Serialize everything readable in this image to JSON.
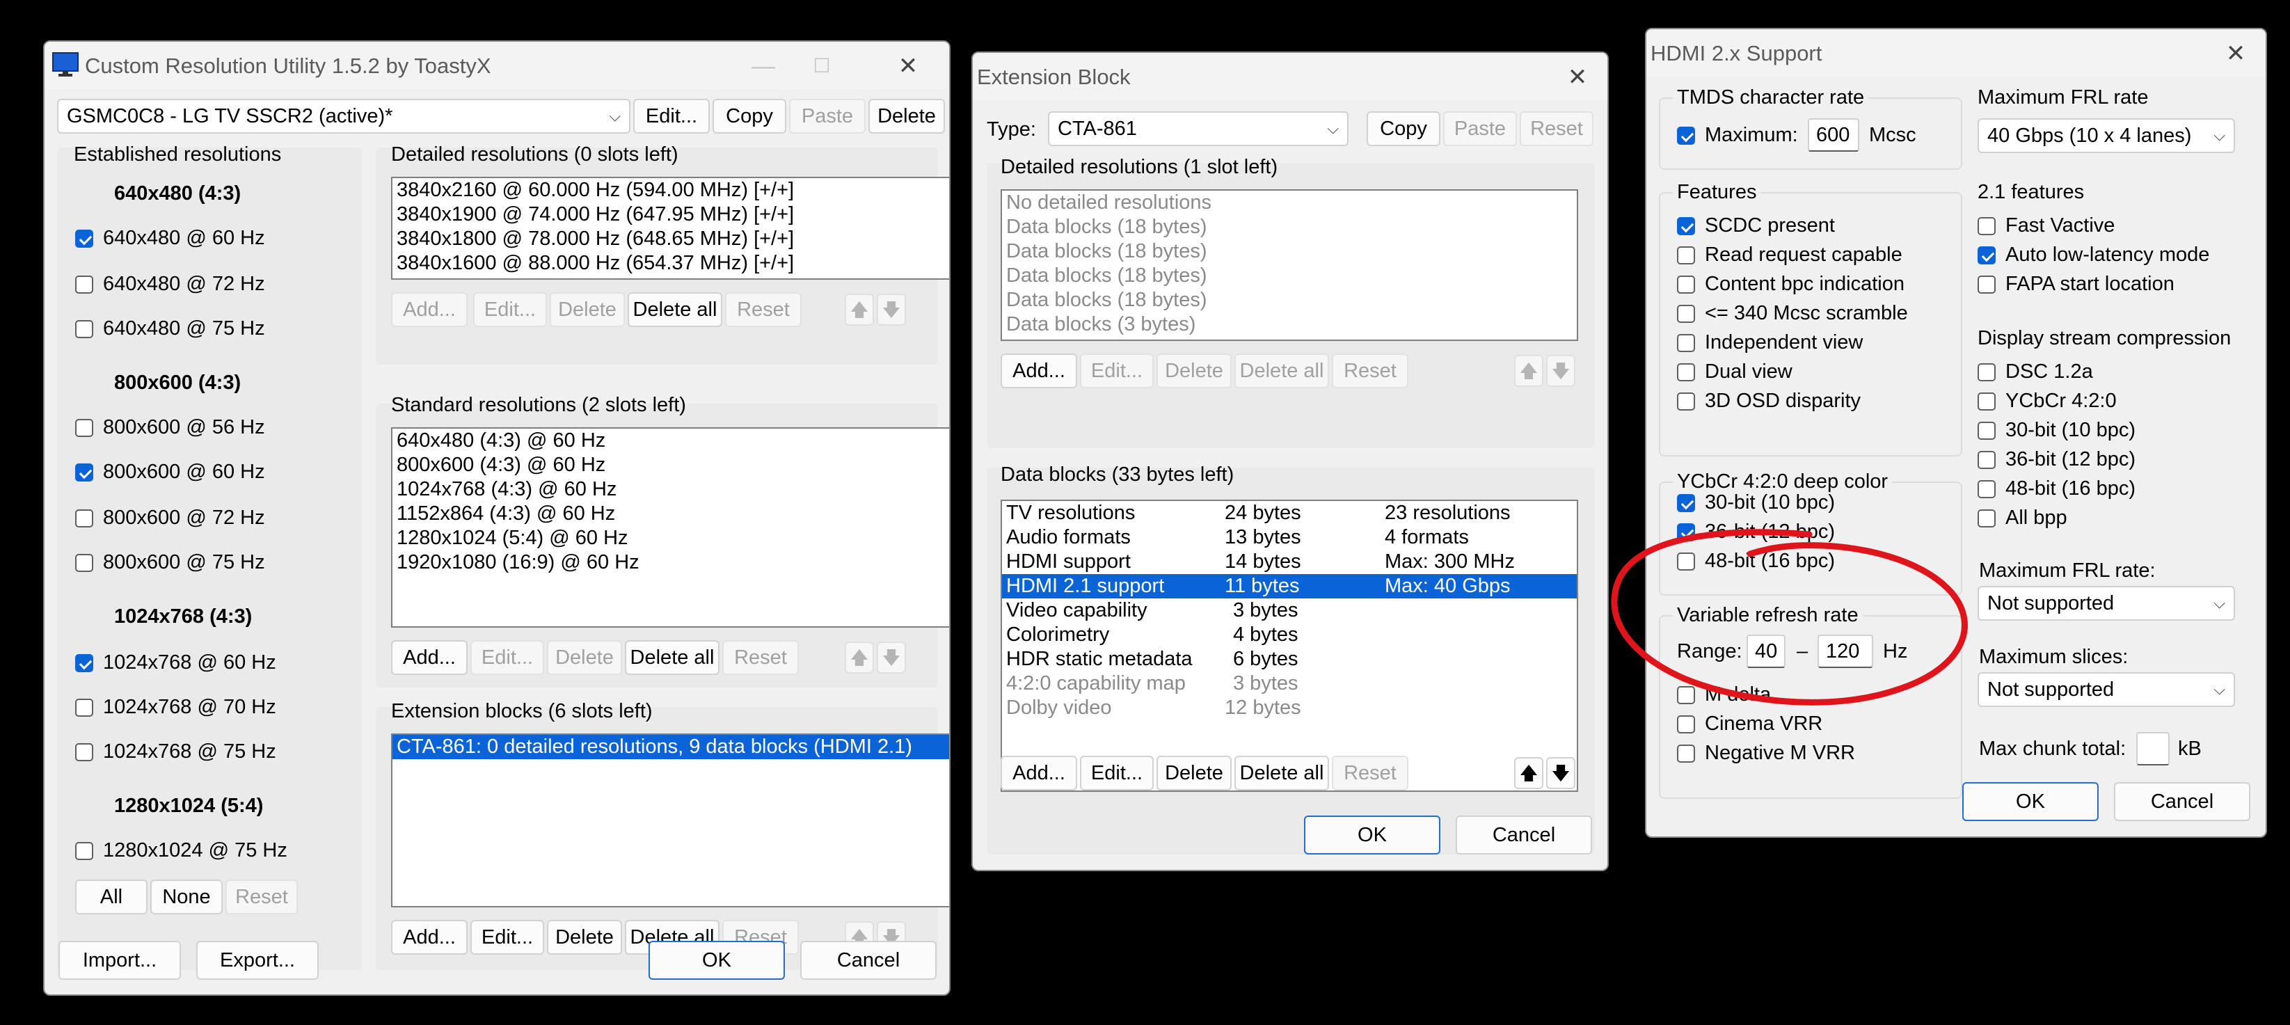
{
  "cru": {
    "title": "Custom Resolution Utility 1.5.2 by ToastyX",
    "monitor": "GSMC0C8 - LG TV SSCR2 (active)*",
    "top_buttons": [
      "Edit...",
      "Copy",
      "Paste",
      "Delete"
    ],
    "established": {
      "title": "Established resolutions",
      "groups": [
        {
          "header": "640x480 (4:3)",
          "items": [
            {
              "label": "640x480 @ 60 Hz",
              "checked": true
            },
            {
              "label": "640x480 @ 72 Hz",
              "checked": false
            },
            {
              "label": "640x480 @ 75 Hz",
              "checked": false
            }
          ]
        },
        {
          "header": "800x600 (4:3)",
          "items": [
            {
              "label": "800x600 @ 56 Hz",
              "checked": false
            },
            {
              "label": "800x600 @ 60 Hz",
              "checked": true
            },
            {
              "label": "800x600 @ 72 Hz",
              "checked": false
            },
            {
              "label": "800x600 @ 75 Hz",
              "checked": false
            }
          ]
        },
        {
          "header": "1024x768 (4:3)",
          "items": [
            {
              "label": "1024x768 @ 60 Hz",
              "checked": true
            },
            {
              "label": "1024x768 @ 70 Hz",
              "checked": false
            },
            {
              "label": "1024x768 @ 75 Hz",
              "checked": false
            }
          ]
        },
        {
          "header": "1280x1024 (5:4)",
          "items": [
            {
              "label": "1280x1024 @ 75 Hz",
              "checked": false
            }
          ]
        }
      ],
      "buttons": [
        "All",
        "None",
        "Reset"
      ]
    },
    "detailed": {
      "title": "Detailed resolutions (0 slots left)",
      "rows": [
        "3840x2160 @ 60.000 Hz (594.00 MHz) [+/+]",
        "3840x1900 @ 74.000 Hz (647.95 MHz) [+/+]",
        "3840x1800 @ 78.000 Hz (648.65 MHz) [+/+]",
        "3840x1600 @ 88.000 Hz (654.37 MHz) [+/+]"
      ]
    },
    "standard": {
      "title": "Standard resolutions (2 slots left)",
      "rows": [
        "640x480 (4:3) @ 60 Hz",
        "800x600 (4:3) @ 60 Hz",
        "1024x768 (4:3) @ 60 Hz",
        "1152x864 (4:3) @ 60 Hz",
        "1280x1024 (5:4) @ 60 Hz",
        "1920x1080 (16:9) @ 60 Hz"
      ]
    },
    "extension": {
      "title": "Extension blocks (6 slots left)",
      "rows": [
        "CTA-861: 0 detailed resolutions, 9 data blocks (HDMI 2.1)"
      ]
    },
    "list_buttons": [
      "Add...",
      "Edit...",
      "Delete",
      "Delete all",
      "Reset"
    ],
    "arrows": [
      "🡅",
      "🡇"
    ],
    "footer": {
      "import": "Import...",
      "export": "Export...",
      "ok": "OK",
      "cancel": "Cancel"
    }
  },
  "ext": {
    "title": "Extension Block",
    "type_label": "Type:",
    "type_value": "CTA-861",
    "top_buttons": [
      "Copy",
      "Paste",
      "Reset"
    ],
    "detailed": {
      "title": "Detailed resolutions (1 slot left)",
      "rows": [
        "No detailed resolutions",
        "Data blocks (18 bytes)",
        "Data blocks (18 bytes)",
        "Data blocks (18 bytes)",
        "Data blocks (18 bytes)",
        "Data blocks (3 bytes)"
      ]
    },
    "datablocks": {
      "title": "Data blocks (33 bytes left)",
      "rows": [
        {
          "name": "TV resolutions",
          "size": "24 bytes",
          "info": "23 resolutions"
        },
        {
          "name": "Audio formats",
          "size": "13 bytes",
          "info": "4 formats"
        },
        {
          "name": "HDMI support",
          "size": "14 bytes",
          "info": "Max: 300 MHz"
        },
        {
          "name": "HDMI 2.1 support",
          "size": "11 bytes",
          "info": "Max: 40 Gbps"
        },
        {
          "name": "Video capability",
          "size": "3 bytes",
          "info": ""
        },
        {
          "name": "Colorimetry",
          "size": "4 bytes",
          "info": ""
        },
        {
          "name": "HDR static metadata",
          "size": "6 bytes",
          "info": ""
        },
        {
          "name": "4:2:0 capability map",
          "size": "3 bytes",
          "info": ""
        },
        {
          "name": "Dolby video",
          "size": "12 bytes",
          "info": ""
        }
      ]
    },
    "list_buttons": [
      "Add...",
      "Edit...",
      "Delete",
      "Delete all",
      "Reset"
    ],
    "arrows": [
      "🡅",
      "🡇"
    ],
    "ok": "OK",
    "cancel": "Cancel"
  },
  "hdmi": {
    "title": "HDMI 2.x Support",
    "tmds": {
      "title": "TMDS character rate",
      "checkbox": "Maximum:",
      "checked": true,
      "value": "600",
      "unit": "Mcsc"
    },
    "features": {
      "title": "Features",
      "items": [
        {
          "label": "SCDC present",
          "checked": true
        },
        {
          "label": "Read request capable",
          "checked": false
        },
        {
          "label": "Content bpc indication",
          "checked": false
        },
        {
          "label": "<= 340 Mcsc scramble",
          "checked": false
        },
        {
          "label": "Independent view",
          "checked": false
        },
        {
          "label": "Dual view",
          "checked": false
        },
        {
          "label": "3D OSD disparity",
          "checked": false
        }
      ]
    },
    "ycbcr": {
      "title": "YCbCr 4:2:0 deep color",
      "items": [
        {
          "label": "30-bit (10 bpc)",
          "checked": true
        },
        {
          "label": "36-bit (12 bpc)",
          "checked": true
        },
        {
          "label": "48-bit (16 bpc)",
          "checked": false
        }
      ]
    },
    "vrr": {
      "title": "Variable refresh rate",
      "range_label": "Range:",
      "min": "40",
      "dash": "–",
      "max": "120",
      "unit": "Hz",
      "items": [
        {
          "label": "M delta",
          "checked": false
        },
        {
          "label": "Cinema VRR",
          "checked": false
        },
        {
          "label": "Negative M VRR",
          "checked": false
        }
      ]
    },
    "frl": {
      "title": "Maximum FRL rate",
      "value": "40 Gbps (10 x 4 lanes)"
    },
    "f21": {
      "title": "2.1 features",
      "items": [
        {
          "label": "Fast Vactive",
          "checked": false
        },
        {
          "label": "Auto low-latency mode",
          "checked": true
        },
        {
          "label": "FAPA start location",
          "checked": false
        }
      ]
    },
    "dsc": {
      "title": "Display stream compression",
      "items": [
        {
          "label": "DSC 1.2a",
          "checked": false
        },
        {
          "label": "YCbCr 4:2:0",
          "checked": false
        },
        {
          "label": "30-bit (10 bpc)",
          "checked": false
        },
        {
          "label": "36-bit (12 bpc)",
          "checked": false
        },
        {
          "label": "48-bit (16 bpc)",
          "checked": false
        },
        {
          "label": "All bpp",
          "checked": false
        }
      ],
      "frl_label": "Maximum FRL rate:",
      "frl_value": "Not supported",
      "slices_label": "Maximum slices:",
      "slices_value": "Not supported",
      "chunk_label": "Max chunk total:",
      "chunk_value": "",
      "chunk_unit": "kB"
    },
    "ok": "OK",
    "cancel": "Cancel"
  },
  "colors": {
    "selection": "#0a64d8",
    "annotation": "#e0151b"
  }
}
